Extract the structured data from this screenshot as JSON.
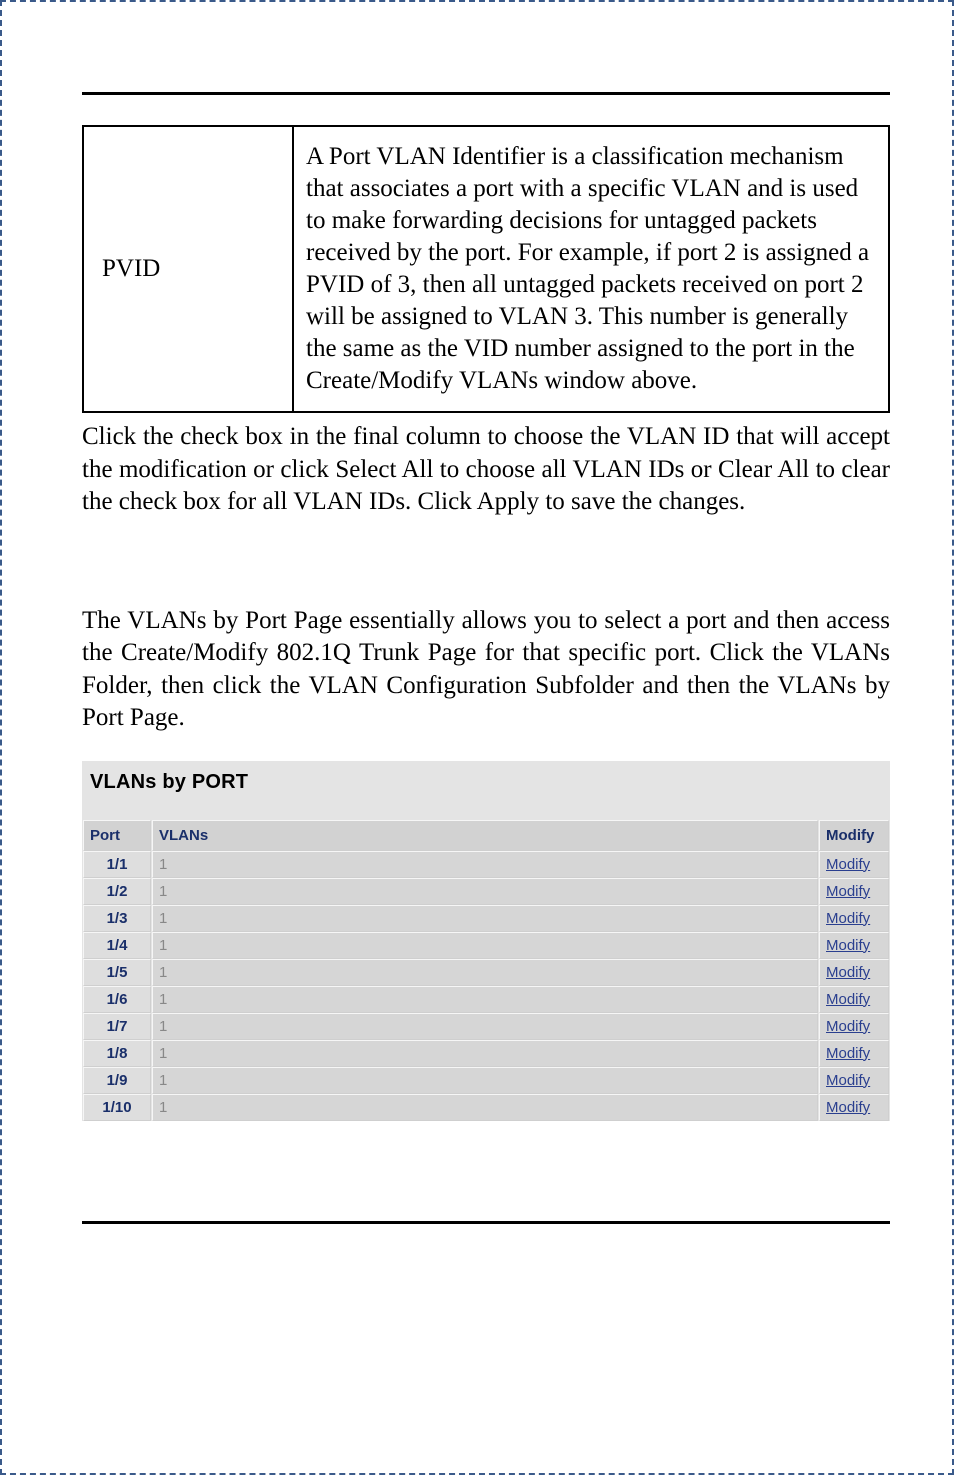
{
  "def_table": {
    "term": "PVID",
    "description": "A Port VLAN Identifier is a classification mechanism that associates a port with a specific VLAN and is used to make forwarding decisions for untagged packets received by the port. For example, if port 2 is assigned a PVID of 3, then all untagged packets received on port 2 will be assigned to VLAN 3. This number is generally the same as the VID number assigned to the port in the Create/Modify VLANs window above."
  },
  "para1": "Click the check box in the final column to choose the VLAN ID that will accept the modification or click Select All to choose all VLAN IDs or Clear All to clear the check box for all VLAN IDs.  Click Apply to save the changes.",
  "para2": "The VLANs by Port Page essentially allows you to select a port and then access the Create/Modify 802.1Q Trunk Page for that specific port. Click the VLANs Folder, then click the VLAN Configuration Subfolder and then the VLANs by Port Page.",
  "screenshot": {
    "title": "VLANs by PORT",
    "headers": {
      "port": "Port",
      "vlans": "VLANs",
      "modify": "Modify"
    },
    "modify_label": "Modify",
    "rows": [
      {
        "port": "1/1",
        "vlans": "1"
      },
      {
        "port": "1/2",
        "vlans": "1"
      },
      {
        "port": "1/3",
        "vlans": "1"
      },
      {
        "port": "1/4",
        "vlans": "1"
      },
      {
        "port": "1/5",
        "vlans": "1"
      },
      {
        "port": "1/6",
        "vlans": "1"
      },
      {
        "port": "1/7",
        "vlans": "1"
      },
      {
        "port": "1/8",
        "vlans": "1"
      },
      {
        "port": "1/9",
        "vlans": "1"
      },
      {
        "port": "1/10",
        "vlans": "1"
      }
    ]
  }
}
